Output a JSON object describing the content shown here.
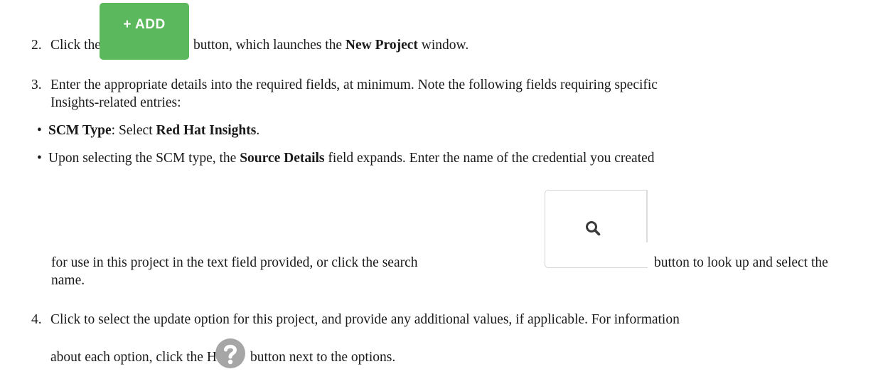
{
  "step2": {
    "number": "2.",
    "prefix": "Click the",
    "add_button_label": "+ ADD",
    "middle": "button, which launches the",
    "window_name": "New Project",
    "suffix": "window."
  },
  "step3": {
    "number": "3.",
    "line1": "Enter the appropriate details into the required fields, at minimum. Note the following fields requiring specific",
    "line2": "Insights-related entries:"
  },
  "bullet1": {
    "marker": "•",
    "label": "SCM Type",
    "middle": ": Select",
    "value": "Red Hat Insights",
    "end": "."
  },
  "bullet2": {
    "marker": "•",
    "line1_prefix": "Upon selecting the SCM type, the",
    "field_name": "Source Details",
    "line1_suffix": "field expands. Enter the name of the credential you created",
    "line2_prefix": "for use in this project in the text field provided, or click the search",
    "line2_suffix": "button to look up and select the",
    "line3": "name."
  },
  "step4": {
    "number": "4.",
    "line1": "Click to select the update option for this project, and provide any additional values, if applicable. For information",
    "line2_prefix": "about each option, click the Help",
    "line2_suffix": "button next to the options."
  },
  "icons": {
    "search": "search-icon",
    "help": "help-icon"
  },
  "colors": {
    "add_button": "#5cb85c",
    "help_icon": "#a6a6a6"
  }
}
